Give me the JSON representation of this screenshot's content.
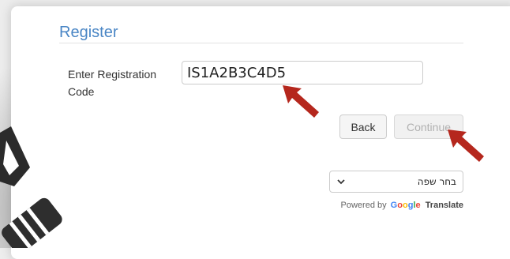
{
  "register": {
    "title": "Register",
    "code_label": "Enter Registration Code",
    "code_value": "IS1A2B3C4D5",
    "back_label": "Back",
    "continue_label": "Continue"
  },
  "translate": {
    "language_select_value": "בחר שפה",
    "powered_by": "Powered by",
    "google_letters": [
      "G",
      "o",
      "o",
      "g",
      "l",
      "e"
    ],
    "translate_label": "Translate"
  },
  "colors": {
    "title": "#4a86c5",
    "annotation_arrow": "#b5271d"
  },
  "icons": {
    "select": "chevron-down-icon",
    "annotation": "red-arrow-icon",
    "background": "decorative-scene"
  }
}
